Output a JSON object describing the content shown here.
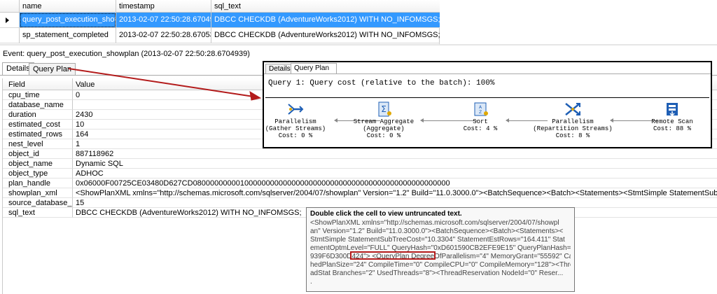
{
  "events_grid": {
    "columns": [
      "name",
      "timestamp",
      "sql_text"
    ],
    "rows": [
      {
        "name": "query_post_execution_showpl...",
        "timestamp": "2013-02-07 22:50:28.6704939",
        "sql_text": "DBCC CHECKDB (AdventureWorks2012) WITH NO_INFOMSGS;"
      },
      {
        "name": "sp_statement_completed",
        "timestamp": "2013-02-07 22:50:28.6705305",
        "sql_text": "DBCC CHECKDB (AdventureWorks2012) WITH NO_INFOMSGS;"
      }
    ]
  },
  "event_label": "Event: query_post_execution_showplan (2013-02-07 22:50:28.6704939)",
  "tabs": {
    "details": "Details",
    "query_plan": "Query Plan"
  },
  "details": {
    "columns": [
      "Field",
      "Value"
    ],
    "rows": [
      {
        "field": "cpu_time",
        "value": "0"
      },
      {
        "field": "database_name",
        "value": ""
      },
      {
        "field": "duration",
        "value": "2430"
      },
      {
        "field": "estimated_cost",
        "value": "10"
      },
      {
        "field": "estimated_rows",
        "value": "164"
      },
      {
        "field": "nest_level",
        "value": "1"
      },
      {
        "field": "object_id",
        "value": "887118962"
      },
      {
        "field": "object_name",
        "value": "Dynamic SQL"
      },
      {
        "field": "object_type",
        "value": "ADHOC"
      },
      {
        "field": "plan_handle",
        "value": "0x06000F00725CE03480D627CD080000000001000000000000000000000000000000000000000000000000"
      },
      {
        "field": "showplan_xml",
        "value": "<ShowPlanXML xmlns=\"http://schemas.microsoft.com/sqlserver/2004/07/showplan\" Version=\"1.2\" Build=\"11.0.3000.0\"><BatchSequence><Batch><Statements><StmtSimple StatementSubTreeCost=\"10.3304\" StatementE..."
      },
      {
        "field": "source_database_id",
        "value": "15"
      },
      {
        "field": "sql_text",
        "value": "DBCC CHECKDB (AdventureWorks2012) WITH NO_INFOMSGS;"
      }
    ]
  },
  "query_plan_panel": {
    "tabs": {
      "details": "Details",
      "query_plan": "Query Plan"
    },
    "query_text": "Query 1: Query cost (relative to the batch): 100%",
    "operators": [
      {
        "line1": "Parallelism",
        "line2": "(Gather Streams)",
        "cost": "Cost: 0 %"
      },
      {
        "line1": "Stream Aggregate",
        "line2": "(Aggregate)",
        "cost": "Cost: 0 %"
      },
      {
        "line1": "Sort",
        "line2": "",
        "cost": "Cost: 4 %"
      },
      {
        "line1": "Parallelism",
        "line2": "(Repartition Streams)",
        "cost": "Cost: 8 %"
      },
      {
        "line1": "Remote Scan",
        "line2": "",
        "cost": "Cost: 88 %"
      }
    ]
  },
  "tooltip": {
    "title": "Double click the cell to view untruncated text.",
    "lines": [
      "<ShowPlanXML xmlns=\"http://schemas.microsoft.com/sqlserver/2004/07/showpl",
      "an\" Version=\"1.2\" Build=\"11.0.3000.0\"><BatchSequence><Batch><Statements><",
      "StmtSimple StatementSubTreeCost=\"10.3304\" StatementEstRows=\"164.411\" Stat",
      "ementOptmLevel=\"FULL\" QueryHash=\"0xD601590CB2EFE9E15\" QueryPlanHash=\"0x5F5",
      "939F6D300D424\"> <QueryPlan DegreeOfParallelism=\"4\" MemoryGrant=\"55592\" Cac",
      "hedPlanSize=\"24\" CompileTime=\"0\" CompileCPU=\"0\" CompileMemory=\"128\"><Thre",
      "adStat Branches=\"2\" UsedThreads=\"8\"><ThreadReservation NodeId=\"0\" Reser...",
      "."
    ]
  },
  "colors": {
    "selection": "#3399ff",
    "annotation_red": "#b31b1b"
  }
}
